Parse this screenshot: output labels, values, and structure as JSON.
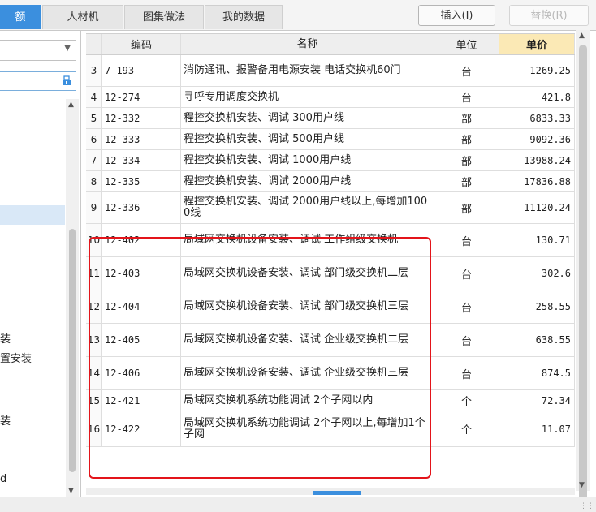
{
  "tabs": [
    {
      "label": "额",
      "active": true
    },
    {
      "label": "人材机",
      "active": false
    },
    {
      "label": "图集做法",
      "active": false
    },
    {
      "label": "我的数据",
      "active": false
    }
  ],
  "toolbar": {
    "insert_label": "插入(I)",
    "replace_label": "替换(R)"
  },
  "sidebar": {
    "items": [
      "装",
      "置安装",
      "装",
      "d"
    ]
  },
  "table": {
    "headers": {
      "code": "编码",
      "name": "名称",
      "unit": "单位",
      "price": "单价"
    },
    "rows": [
      {
        "num": "3",
        "code": "7-193",
        "name": "消防通讯、报警备用电源安装 电话交换机60门",
        "unit": "台",
        "price": "1269.25"
      },
      {
        "num": "4",
        "code": "12-274",
        "name": "寻呼专用调度交换机",
        "unit": "台",
        "price": "421.8"
      },
      {
        "num": "5",
        "code": "12-332",
        "name": "程控交换机安装、调试 300用户线",
        "unit": "部",
        "price": "6833.33"
      },
      {
        "num": "6",
        "code": "12-333",
        "name": "程控交换机安装、调试 500用户线",
        "unit": "部",
        "price": "9092.36"
      },
      {
        "num": "7",
        "code": "12-334",
        "name": "程控交换机安装、调试 1000用户线",
        "unit": "部",
        "price": "13988.24"
      },
      {
        "num": "8",
        "code": "12-335",
        "name": "程控交换机安装、调试 2000用户线",
        "unit": "部",
        "price": "17836.88"
      },
      {
        "num": "9",
        "code": "12-336",
        "name": "程控交换机安装、调试 2000用户线以上,每增加1000线",
        "unit": "部",
        "price": "11120.24"
      },
      {
        "num": "10",
        "code": "12-402",
        "name": "局域网交换机设备安装、调试 工作组级交换机",
        "unit": "台",
        "price": "130.71"
      },
      {
        "num": "11",
        "code": "12-403",
        "name": "局域网交换机设备安装、调试 部门级交换机二层",
        "unit": "台",
        "price": "302.6"
      },
      {
        "num": "12",
        "code": "12-404",
        "name": "局域网交换机设备安装、调试 部门级交换机三层",
        "unit": "台",
        "price": "258.55"
      },
      {
        "num": "13",
        "code": "12-405",
        "name": "局域网交换机设备安装、调试 企业级交换机二层",
        "unit": "台",
        "price": "638.55"
      },
      {
        "num": "14",
        "code": "12-406",
        "name": "局域网交换机设备安装、调试 企业级交换机三层",
        "unit": "台",
        "price": "874.5"
      },
      {
        "num": "15",
        "code": "12-421",
        "name": "局域网交换机系统功能调试 2个子网以内",
        "unit": "个",
        "price": "72.34"
      },
      {
        "num": "16",
        "code": "12-422",
        "name": "局域网交换机系统功能调试 2个子网以上,每增加1个子网",
        "unit": "个",
        "price": "11.07"
      }
    ]
  },
  "colors": {
    "accent": "#3b8fde",
    "highlight_border": "#e3141a",
    "price_header": "#fbe9b5"
  }
}
